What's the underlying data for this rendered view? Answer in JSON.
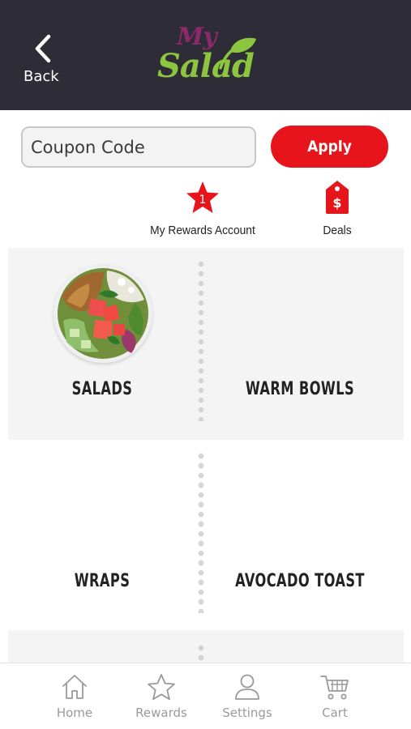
{
  "header": {
    "back_label": "Back",
    "logo_top": "My",
    "logo_bottom": "Salad"
  },
  "coupon": {
    "placeholder": "Coupon Code",
    "apply_label": "Apply"
  },
  "quick_links": {
    "rewards_badge": "1",
    "rewards_label": "My Rewards Account",
    "deals_label": "Deals",
    "deals_icon_symbol": "$"
  },
  "categories": [
    {
      "label": "SALADS"
    },
    {
      "label": "WARM BOWLS"
    },
    {
      "label": "WRAPS"
    },
    {
      "label": "AVOCADO TOAST"
    }
  ],
  "tabbar": {
    "items": [
      {
        "label": "Home",
        "icon": "home-icon"
      },
      {
        "label": "Rewards",
        "icon": "star-icon"
      },
      {
        "label": "Settings",
        "icon": "person-icon"
      },
      {
        "label": "Cart",
        "icon": "cart-icon"
      }
    ]
  },
  "colors": {
    "header_bg": "#2e2c36",
    "accent_red": "#e8141b",
    "logo_purple": "#8b2a6a",
    "logo_green": "#8cc63f",
    "tile_bg": "#f4f4f4",
    "tab_gray": "#9a9a9a"
  }
}
